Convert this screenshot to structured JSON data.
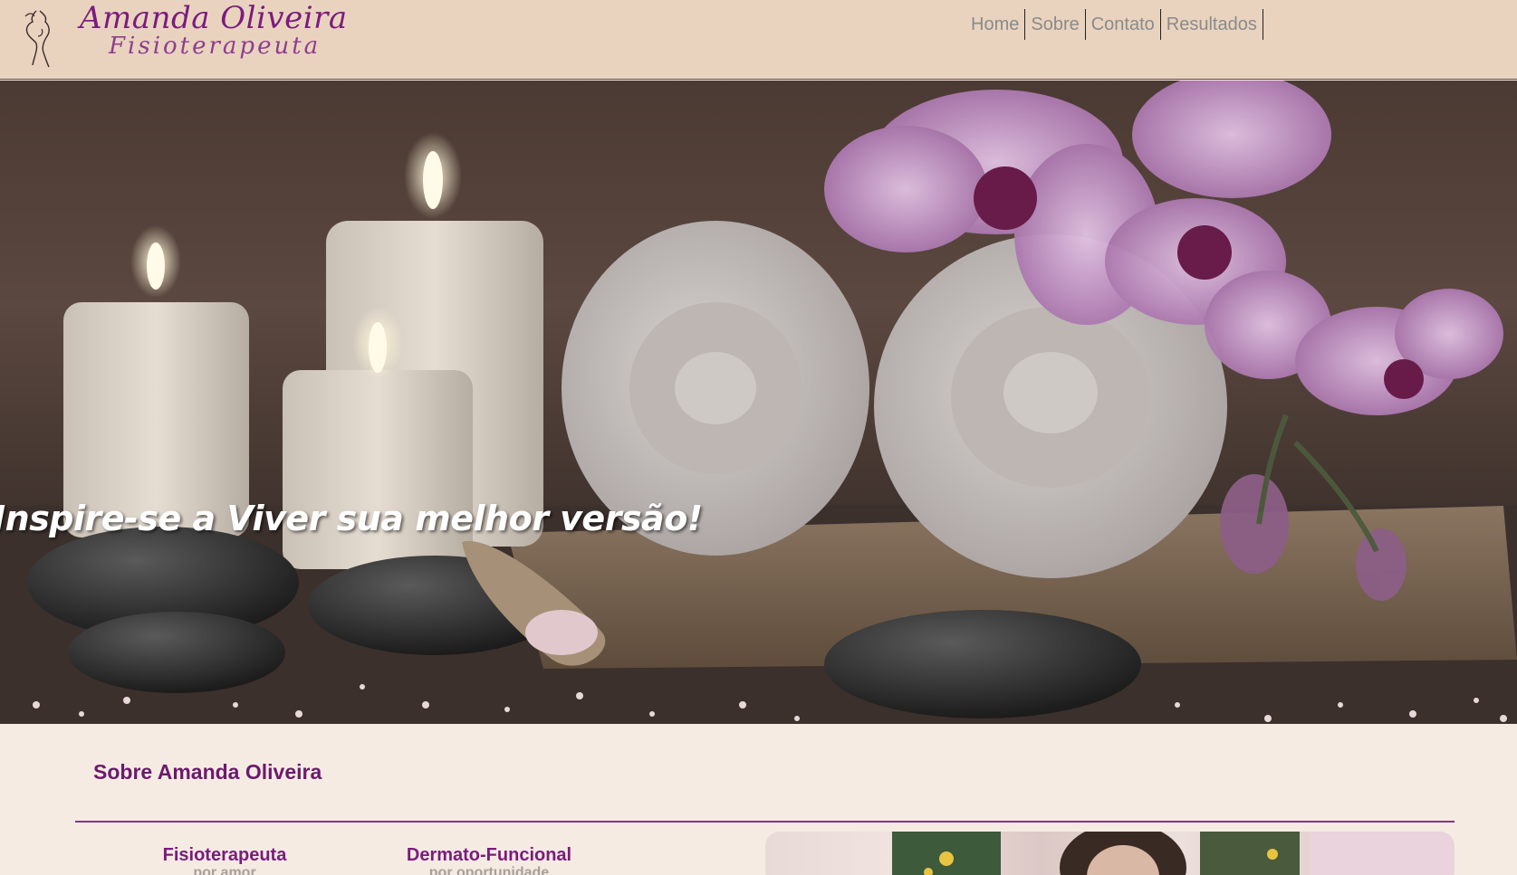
{
  "header": {
    "logo_name": "Amanda Oliveira",
    "logo_sub": "Fisioterapeuta"
  },
  "nav": {
    "items": [
      "Home",
      "Sobre",
      "Contato",
      "Resultados"
    ]
  },
  "hero": {
    "tagline": "Inspire-se a Viver sua melhor versão!"
  },
  "about": {
    "title": "Sobre Amanda Oliveira",
    "cards": [
      {
        "title": "Fisioterapeuta",
        "subtitle": "por amor"
      },
      {
        "title": "Dermato-Funcional",
        "subtitle": "por oportunidade"
      }
    ]
  },
  "colors": {
    "header_bg": "#e9d3bf",
    "page_bg": "#f6ebe3",
    "brand_purple": "#7b1b7e",
    "nav_text": "#8a8a8a"
  }
}
